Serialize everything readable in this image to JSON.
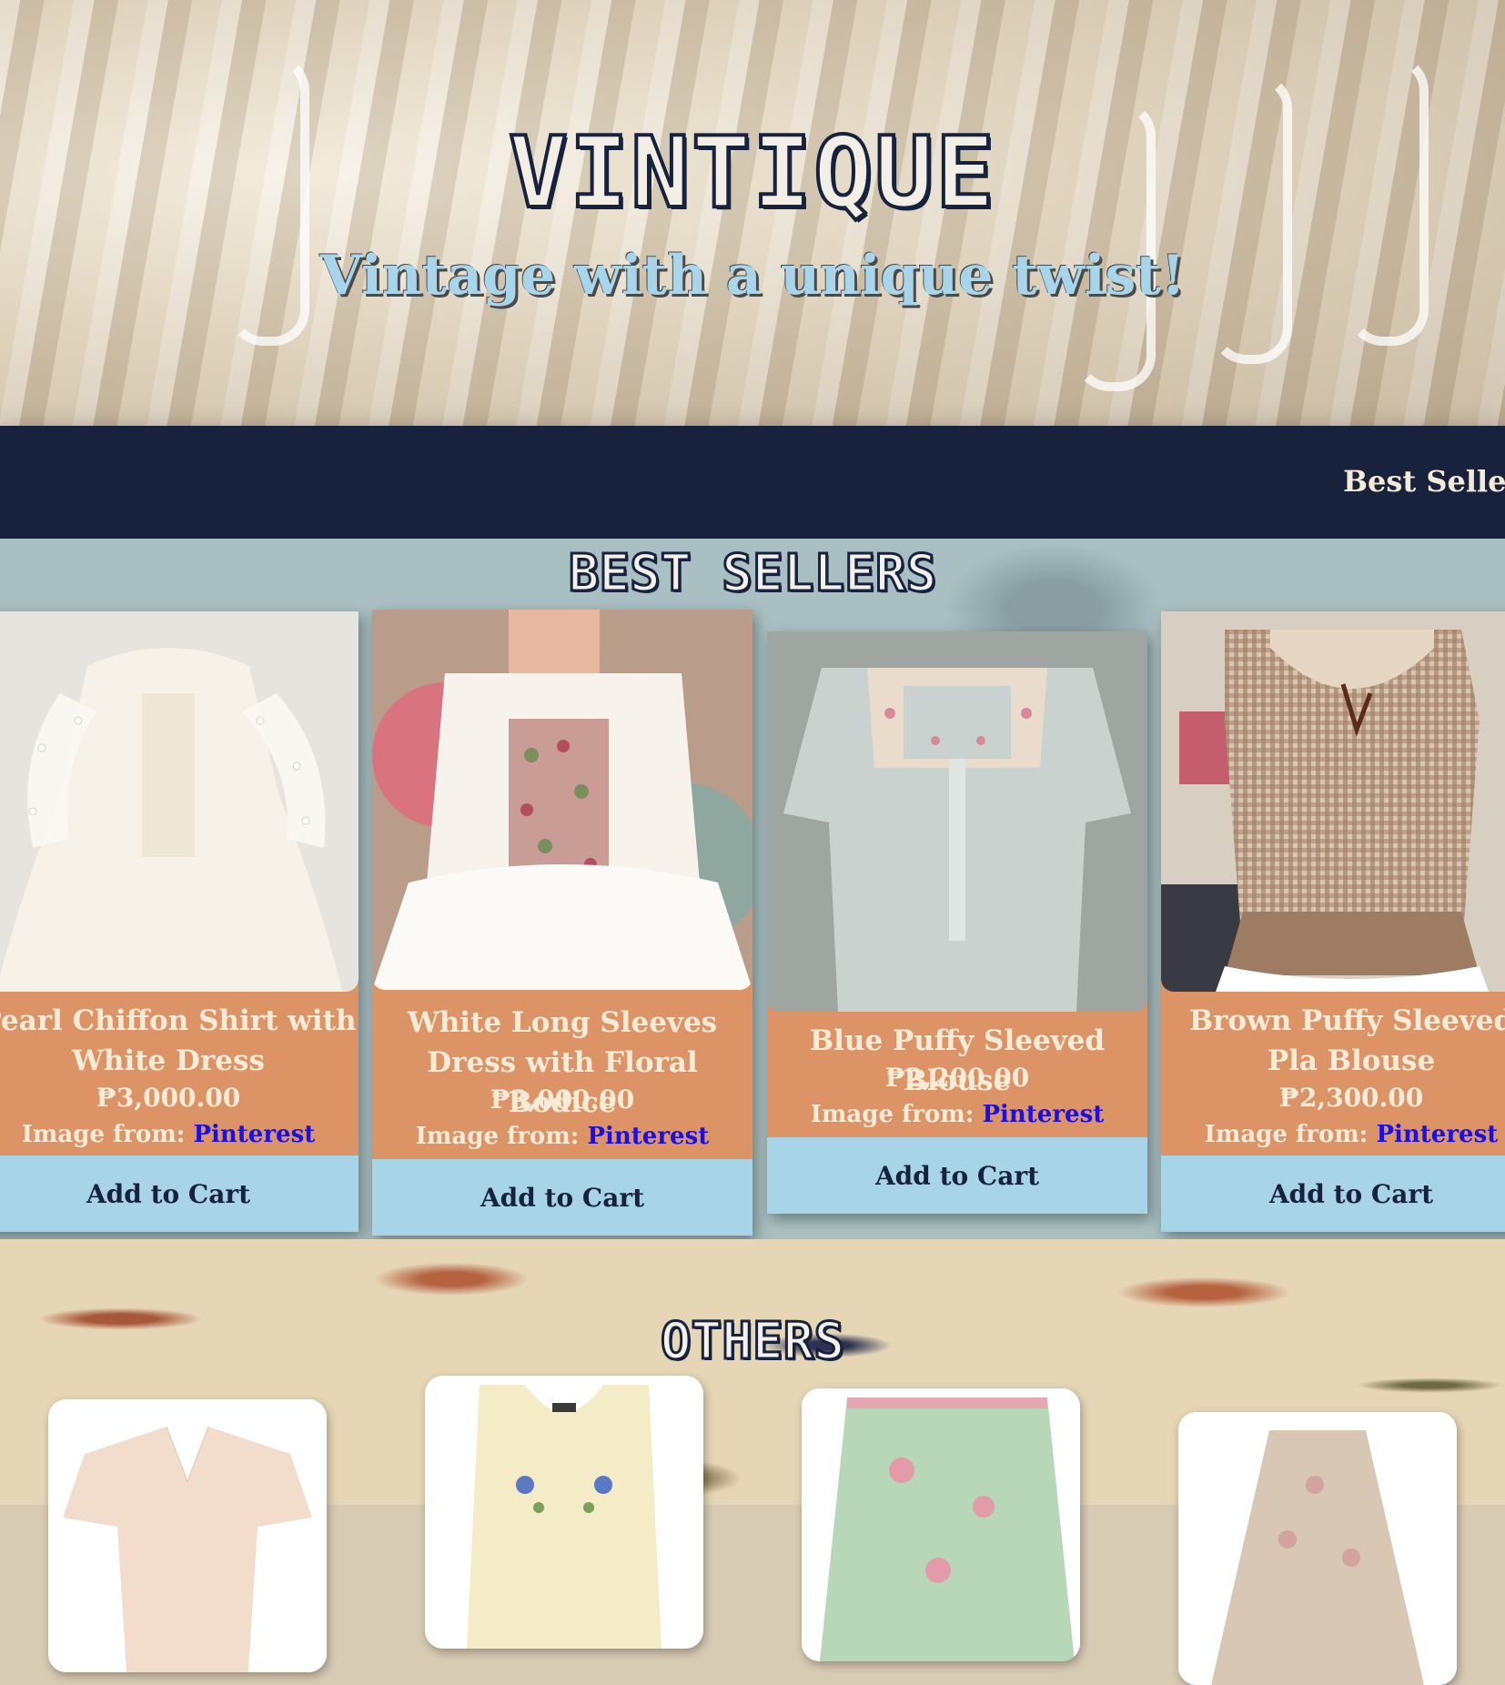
{
  "hero": {
    "brand": "VINTIQUE",
    "tagline": "Vintage with a unique twist!"
  },
  "nav": {
    "items": [
      "Best Sellers"
    ]
  },
  "best_sellers": {
    "title": "BEST SELLERS",
    "products": [
      {
        "name": "Pearl Chiffon Shirt with White Dress",
        "price": "₱3,000.00",
        "credit_label": "Image from:",
        "credit_link": "Pinterest",
        "button": "Add to Cart"
      },
      {
        "name": "White Long Sleeves Dress with Floral Bodice",
        "price": "₱3,000.00",
        "credit_label": "Image from:",
        "credit_link": "Pinterest",
        "button": "Add to Cart"
      },
      {
        "name": "Blue Puffy Sleeved Blouse",
        "price": "₱2,200.00",
        "credit_label": "Image from:",
        "credit_link": "Pinterest",
        "button": "Add to Cart"
      },
      {
        "name": "Brown Puffy Sleeved Pla Blouse",
        "price": "₱2,300.00",
        "credit_label": "Image from:",
        "credit_link": "Pinterest",
        "button": "Add to Cart"
      }
    ]
  },
  "others": {
    "title": "OTHERS"
  },
  "colors": {
    "navy": "#18223d",
    "card": "#dc9366",
    "button": "#a8d4e8",
    "link": "#1a10e6",
    "cream": "#f6ebd6"
  }
}
